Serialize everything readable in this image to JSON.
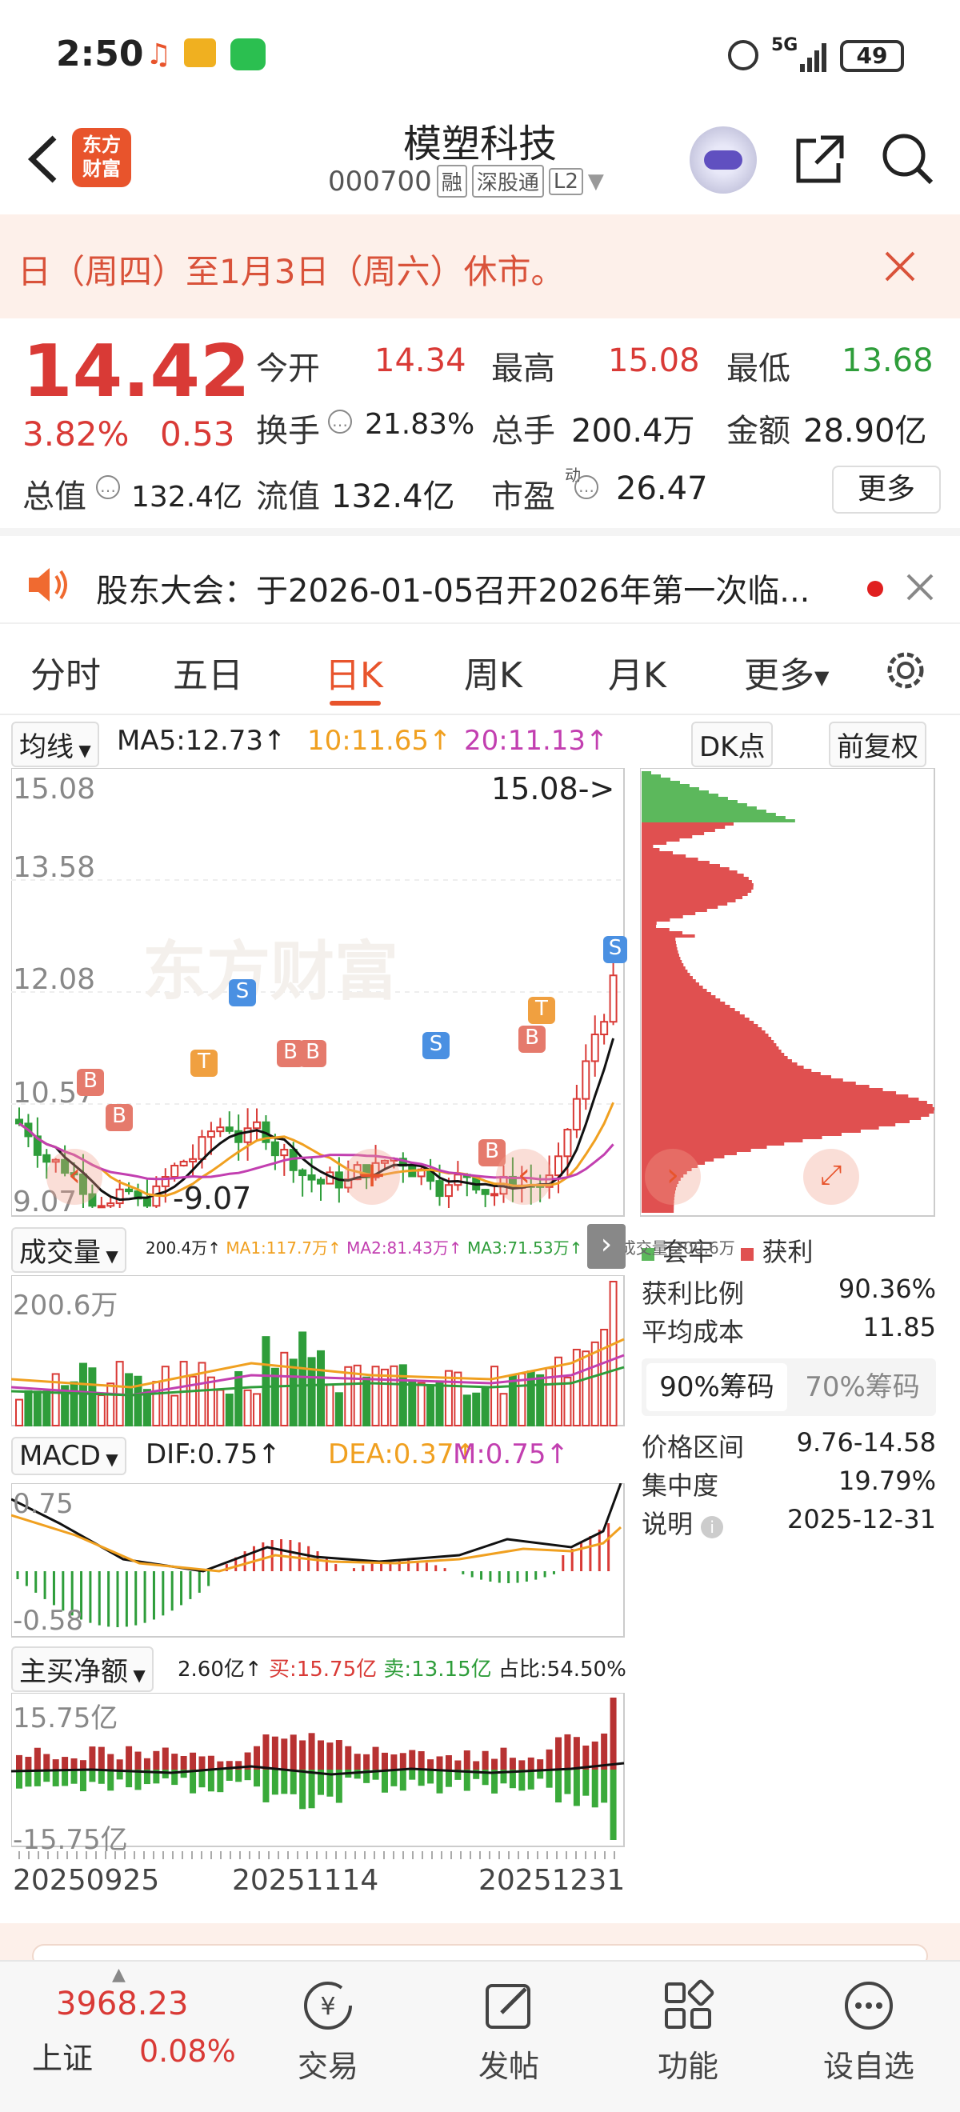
{
  "statusbar": {
    "time": "2:50",
    "network": "5G",
    "battery": "49"
  },
  "header": {
    "title": "模塑科技",
    "code": "000700",
    "tag_rong": "融",
    "tag_sgt": "深股通",
    "tag_l2": "L2",
    "app_logo": "东方\n财富"
  },
  "notice": {
    "text": "日（周四）至1月3日（周六）休市。"
  },
  "quote": {
    "price": "14.42",
    "change_pct": "3.82%",
    "change": "0.53",
    "open_label": "今开",
    "open": "14.34",
    "high_label": "最高",
    "high": "15.08",
    "low_label": "最低",
    "low": "13.68",
    "turnover_label": "换手",
    "turnover": "21.83%",
    "volume_label": "总手",
    "volume": "200.4万",
    "amount_label": "金额",
    "amount": "28.90亿",
    "mktcap_label": "总值",
    "mktcap": "132.4亿",
    "float_label": "流值",
    "float": "132.4亿",
    "pe_label": "市盈",
    "pe_sup": "动",
    "pe": "26.47",
    "more_button": "更多"
  },
  "meeting": {
    "text": "股东大会：于2026-01-05召开2026年第一次临..."
  },
  "tabs": [
    "分时",
    "五日",
    "日K",
    "周K",
    "月K",
    "更多"
  ],
  "active_tab": "日K",
  "chart": {
    "ma_selector": "均线",
    "ma5": "MA5:12.73↑",
    "ma10": "10:11.65↑",
    "ma20": "20:11.13↑",
    "dk_button": "DK点",
    "fq_button": "前复权",
    "y_high": "15.08",
    "y_mid1": "13.58",
    "y_mid2": "12.08",
    "y_mid3": "10.57",
    "y_low": "9.07",
    "high_marker": "15.08->",
    "low_marker": "-9.07",
    "vol_selector": "成交量",
    "vol_legend": {
      "vol": "200.4万↑",
      "ma1": "MA1:117.7万↑",
      "ma2": "MA2:81.43万↑",
      "ma3": "MA3:71.53万↑",
      "virtual": "虚拟成交量:200.6万"
    },
    "vol_axis": "200.6万",
    "macd_selector": "MACD",
    "dif": "DIF:0.75↑",
    "dea": "DEA:0.37↑",
    "m": "M:0.75↑",
    "macd_top": "0.75",
    "macd_bottom": "-0.58",
    "flow_selector": "主买净额",
    "flow_net": "2.60亿↑",
    "flow_buy": "买:15.75亿",
    "flow_sell": "卖:13.15亿",
    "flow_ratio": "占比:54.50%",
    "flow_top": "15.75亿",
    "flow_bottom": "-15.75亿",
    "dates": [
      "20250925",
      "20251114",
      "20251231"
    ]
  },
  "chips": {
    "legend_trapped": "套牢",
    "legend_profit": "获利",
    "profit_ratio_label": "获利比例",
    "profit_ratio": "90.36%",
    "avg_cost_label": "平均成本",
    "avg_cost": "11.85",
    "tab90": "90%筹码",
    "tab70": "70%筹码",
    "range_label": "价格区间",
    "range": "9.76-14.58",
    "concentration_label": "集中度",
    "concentration": "19.79%",
    "note_label": "说明",
    "note_date": "2025-12-31"
  },
  "bottom_nav": {
    "index_value": "3968.23",
    "index_name": "上证",
    "index_pct": "0.08%",
    "trade": "交易",
    "post": "发帖",
    "function": "功能",
    "watchlist": "设自选"
  },
  "colors": {
    "up": "#d93a36",
    "down": "#2e9d3a",
    "accent": "#e8542c",
    "ma10": "#f0a020",
    "ma20": "#c23fb0"
  }
}
